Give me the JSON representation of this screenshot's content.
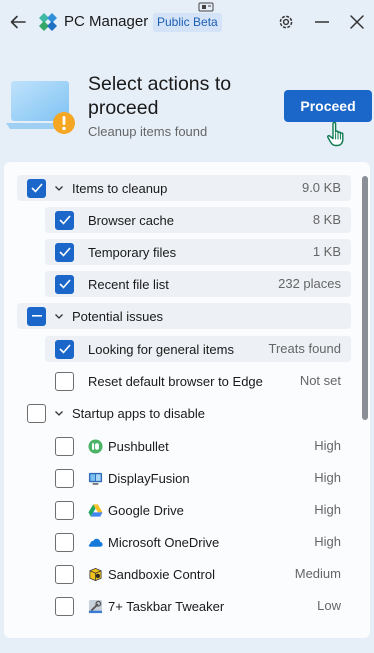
{
  "titlebar": {
    "title": "PC Manager",
    "badge": "Public Beta"
  },
  "hero": {
    "title": "Select actions to proceed",
    "subtitle": "Cleanup items found",
    "proceed_label": "Proceed"
  },
  "groups": {
    "cleanup": {
      "label": "Items to cleanup",
      "value": "9.0 KB",
      "checked": "true",
      "items": [
        {
          "label": "Browser cache",
          "value": "8 KB",
          "checked": "true"
        },
        {
          "label": "Temporary files",
          "value": "1 KB",
          "checked": "true"
        },
        {
          "label": "Recent file list",
          "value": "232 places",
          "checked": "true"
        }
      ]
    },
    "issues": {
      "label": "Potential issues",
      "checked": "partial",
      "items": [
        {
          "label": "Looking for general items",
          "value": "Treats found",
          "checked": "true"
        },
        {
          "label": "Reset default browser to Edge",
          "value": "Not set",
          "checked": "false"
        }
      ]
    },
    "startup": {
      "label": "Startup apps to disable",
      "checked": "false",
      "items": [
        {
          "label": "Pushbullet",
          "value": "High",
          "icon": "pushbullet-icon",
          "checked": "false"
        },
        {
          "label": "DisplayFusion",
          "value": "High",
          "icon": "displayfusion-icon",
          "checked": "false"
        },
        {
          "label": "Google Drive",
          "value": "High",
          "icon": "google-drive-icon",
          "checked": "false"
        },
        {
          "label": "Microsoft OneDrive",
          "value": "High",
          "icon": "onedrive-icon",
          "checked": "false"
        },
        {
          "label": "Sandboxie Control",
          "value": "Medium",
          "icon": "sandboxie-icon",
          "checked": "false"
        },
        {
          "label": "7+ Taskbar Tweaker",
          "value": "Low",
          "icon": "taskbar-tweaker-icon",
          "checked": "false"
        }
      ]
    }
  },
  "colors": {
    "accent": "#1a66c9",
    "background": "#e6eef8",
    "panel": "#fbfcfe",
    "warning": "#f5a623"
  }
}
